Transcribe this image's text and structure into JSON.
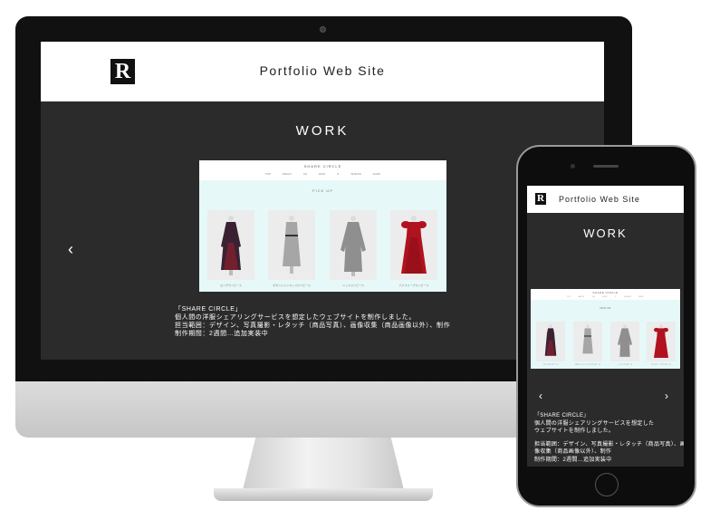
{
  "site": {
    "logo_letter": "R",
    "title": "Portfolio Web Site",
    "section_title": "WORK",
    "prev_arrow": "‹",
    "next_arrow": "›"
  },
  "thumbnail": {
    "brand": "SHARE CIRCLE",
    "nav": [
      "TOP",
      "ABOUT US",
      "HOW IT WORKS",
      "SHOP"
    ],
    "pick_up": "PICK UP",
    "items": [
      {
        "caption": "ロングワンピース",
        "color": "#3a2233",
        "accent": "#8c1f2c"
      },
      {
        "caption": "ボタンシャツドレスワンピース",
        "color": "#a6a6a6",
        "accent": "#333333"
      },
      {
        "caption": "ニットワンピース",
        "color": "#8f8f8f",
        "accent": "#7a7a7a"
      },
      {
        "caption": "パフスリーブワンピース",
        "color": "#b1121f",
        "accent": "#8a0f18"
      }
    ]
  },
  "description": {
    "line1": "「SHARE CIRCLE」",
    "line2": "個人間の洋服シェアリングサービスを想定したウェブサイトを制作しました。",
    "line3": "担当範囲：デザイン、写真撮影・レタッチ（商品写真）、画像収集（商品画像以外）、制作",
    "line4": "制作期間：2週間…追加実装中"
  },
  "mobile_description": {
    "line1": "「SHARE CIRCLE」",
    "line2a": "個人間の洋服シェアリングサービスを想定した",
    "line2b": "ウェブサイトを制作しました。",
    "line3a": "担当範囲：デザイン、写真撮影・レタッチ（商品写真）、画",
    "line3b": "像収集（商品画像以外）、制作",
    "line4": "制作期間：2週間…追加実装中"
  },
  "colors": {
    "screen_bg": "#2b2b2b",
    "header_bg": "#ffffff",
    "thumb_body_bg": "#e6f8f8"
  }
}
